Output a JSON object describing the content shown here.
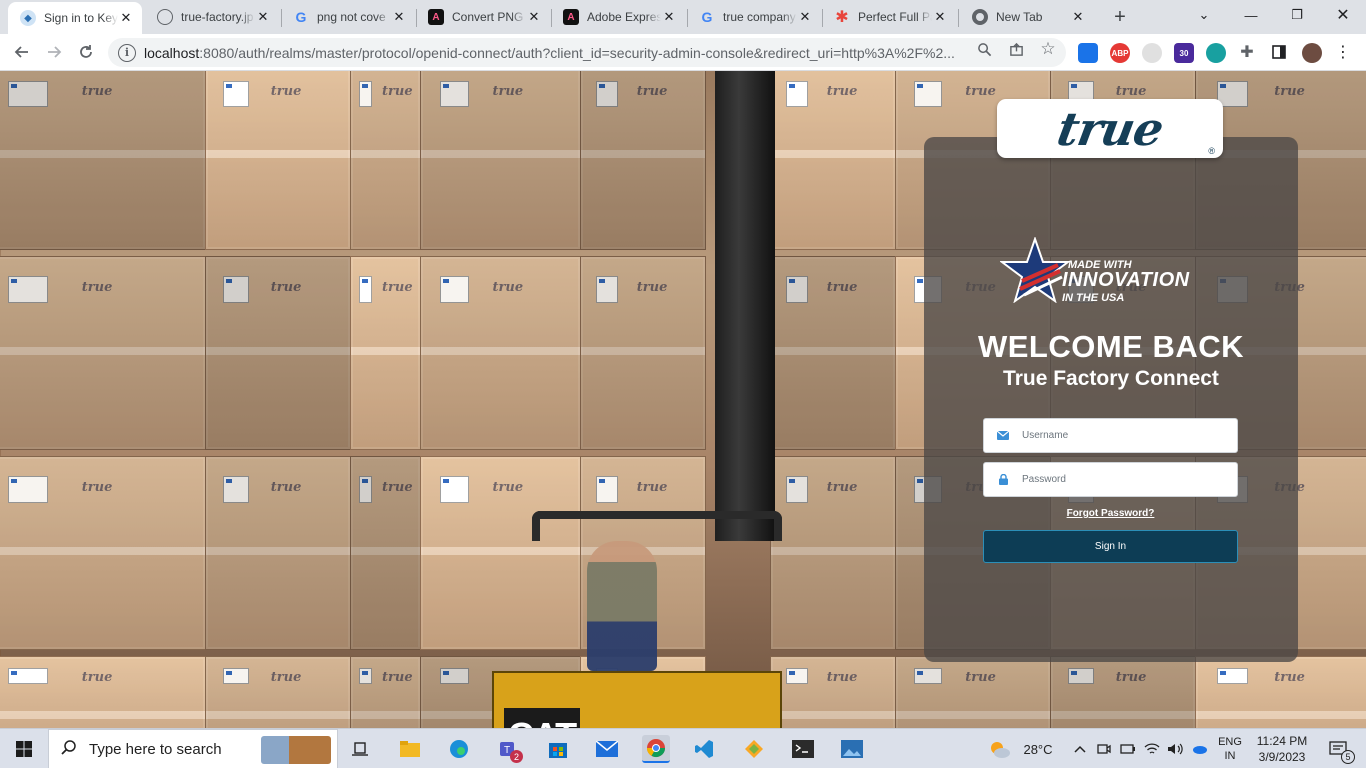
{
  "browser": {
    "tabs": [
      {
        "title": "Sign in to Key",
        "favicon": "keycloak-icon",
        "fav_color": "#4d8fcf",
        "active": true
      },
      {
        "title": "true-factory.jp",
        "favicon": "globe-icon",
        "fav_color": "#5f6368",
        "active": false
      },
      {
        "title": "png not cove",
        "favicon": "google-icon",
        "fav_color": "#4285f4",
        "active": false
      },
      {
        "title": "Convert PNG",
        "favicon": "adobe-express-icon",
        "fav_color": "#1a1a1a",
        "active": false
      },
      {
        "title": "Adobe Expres",
        "favicon": "adobe-express-icon",
        "fav_color": "#1a1a1a",
        "active": false
      },
      {
        "title": "true company",
        "favicon": "google-icon",
        "fav_color": "#4285f4",
        "active": false
      },
      {
        "title": "Perfect Full Pa",
        "favicon": "asterisk-icon",
        "fav_color": "#e8453c",
        "active": false
      },
      {
        "title": "New Tab",
        "favicon": "chrome-icon",
        "fav_color": "#5f6368",
        "active": false
      }
    ],
    "url_host": "localhost",
    "url_rest": ":8080/auth/realms/master/protocol/openid-connect/auth?client_id=security-admin-console&redirect_uri=http%3A%2F%2...",
    "extensions": [
      {
        "name": "translate-extension-icon",
        "color": "#1a73e8",
        "label": ""
      },
      {
        "name": "adblock-extension-icon",
        "color": "#e53935",
        "label": "ABP"
      },
      {
        "name": "ghost-extension-icon",
        "color": "#bdbdbd",
        "label": ""
      },
      {
        "name": "graduation-extension-icon",
        "color": "#4a2a9c",
        "label": "30"
      },
      {
        "name": "circle-extension-icon",
        "color": "#18a0a0",
        "label": ""
      }
    ]
  },
  "login": {
    "logo_text": "true",
    "logo_reg": "®",
    "badge": {
      "small": "MADE WITH",
      "big": "INNOVATION",
      "usa": "IN THE USA"
    },
    "welcome": "WELCOME BACK",
    "subtitle": "True Factory Connect",
    "username_placeholder": "Username",
    "password_placeholder": "Password",
    "forgot": "Forgot Password?",
    "signin": "Sign In",
    "accent": "#0d3d55"
  },
  "background": {
    "forklift_label": "CAT",
    "box_brand": "true"
  },
  "taskbar": {
    "search_placeholder": "Type here to search",
    "weather": "28°C",
    "language_top": "ENG",
    "language_bottom": "IN",
    "time": "11:24 PM",
    "date": "3/9/2023",
    "notifications": "5",
    "teams_badge": "2"
  }
}
